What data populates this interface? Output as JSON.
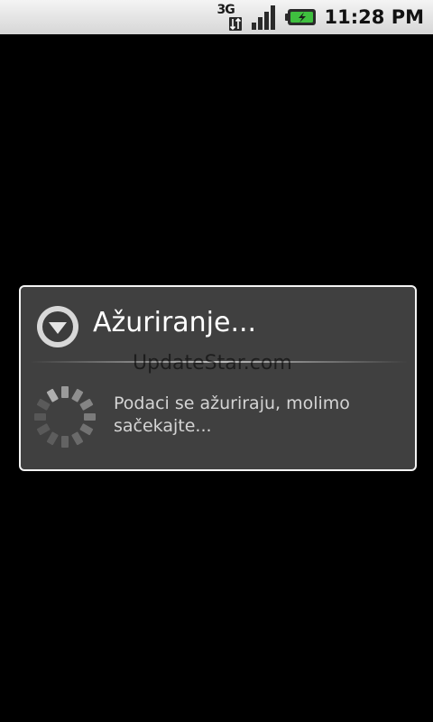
{
  "status_bar": {
    "network_type": "3G",
    "network_icon": "network-3g-icon",
    "signal_icon": "signal-strength-icon",
    "battery_icon": "battery-charging-icon",
    "time": "11:28 PM"
  },
  "dialog": {
    "title": "Ažuriranje...",
    "title_icon": "alert-triangle-down-icon",
    "message": "Podaci se ažuriraju, molimo sačekajte...",
    "spinner_icon": "loading-spinner-icon",
    "watermark": "UpdateStar.com"
  },
  "colors": {
    "background": "#000000",
    "status_bar": "#e4e4e4",
    "dialog_background": "#404040",
    "dialog_border": "#f4f4f4",
    "title_text": "#ffffff",
    "message_text": "#d4d4d4",
    "battery_accent": "#3fbf3f"
  }
}
